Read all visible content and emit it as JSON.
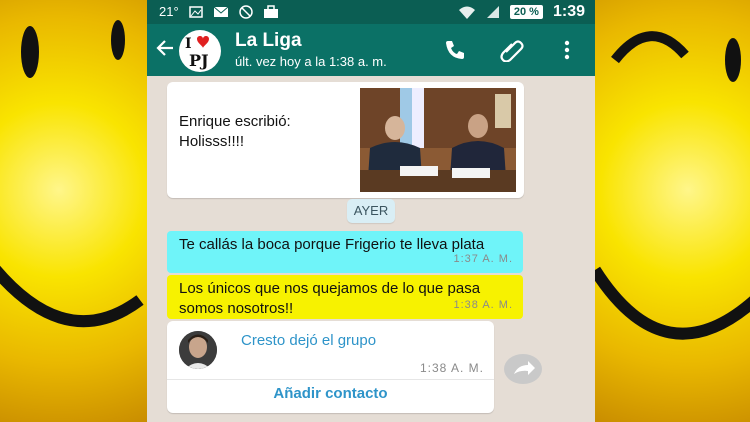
{
  "status_bar": {
    "temperature": "21°",
    "battery": "20 %",
    "time": "1:39"
  },
  "header": {
    "avatar_logo_top": "I",
    "avatar_logo_bottom": "PJ",
    "title": "La Liga",
    "subtitle": "últ. vez hoy a la 1:38 a. m."
  },
  "messages": {
    "photo_caption_line1": "Enrique escribió:",
    "photo_caption_line2": "Holisss!!!!",
    "date_chip": "AYER",
    "msg1_text": "Te callás la boca porque Frigerio te lleva plata",
    "msg1_time": "1:37 A. M.",
    "msg2_text": "Los únicos que nos quejamos de lo que pasa somos nosotros!!",
    "msg2_time": "1:38 A. M.",
    "system_text": "Cresto dejó el grupo",
    "system_time": "1:38 A. M.",
    "add_contact": "Añadir contacto"
  },
  "colors": {
    "header_green": "#0b7166",
    "highlight_cyan": "#6ff4f9",
    "highlight_yellow": "#f7f200",
    "link_blue": "#2e94c9"
  },
  "icons": [
    "back-arrow-icon",
    "phone-icon",
    "attach-icon",
    "more-vert-icon",
    "forward-icon",
    "wifi-icon",
    "signal-icon"
  ]
}
